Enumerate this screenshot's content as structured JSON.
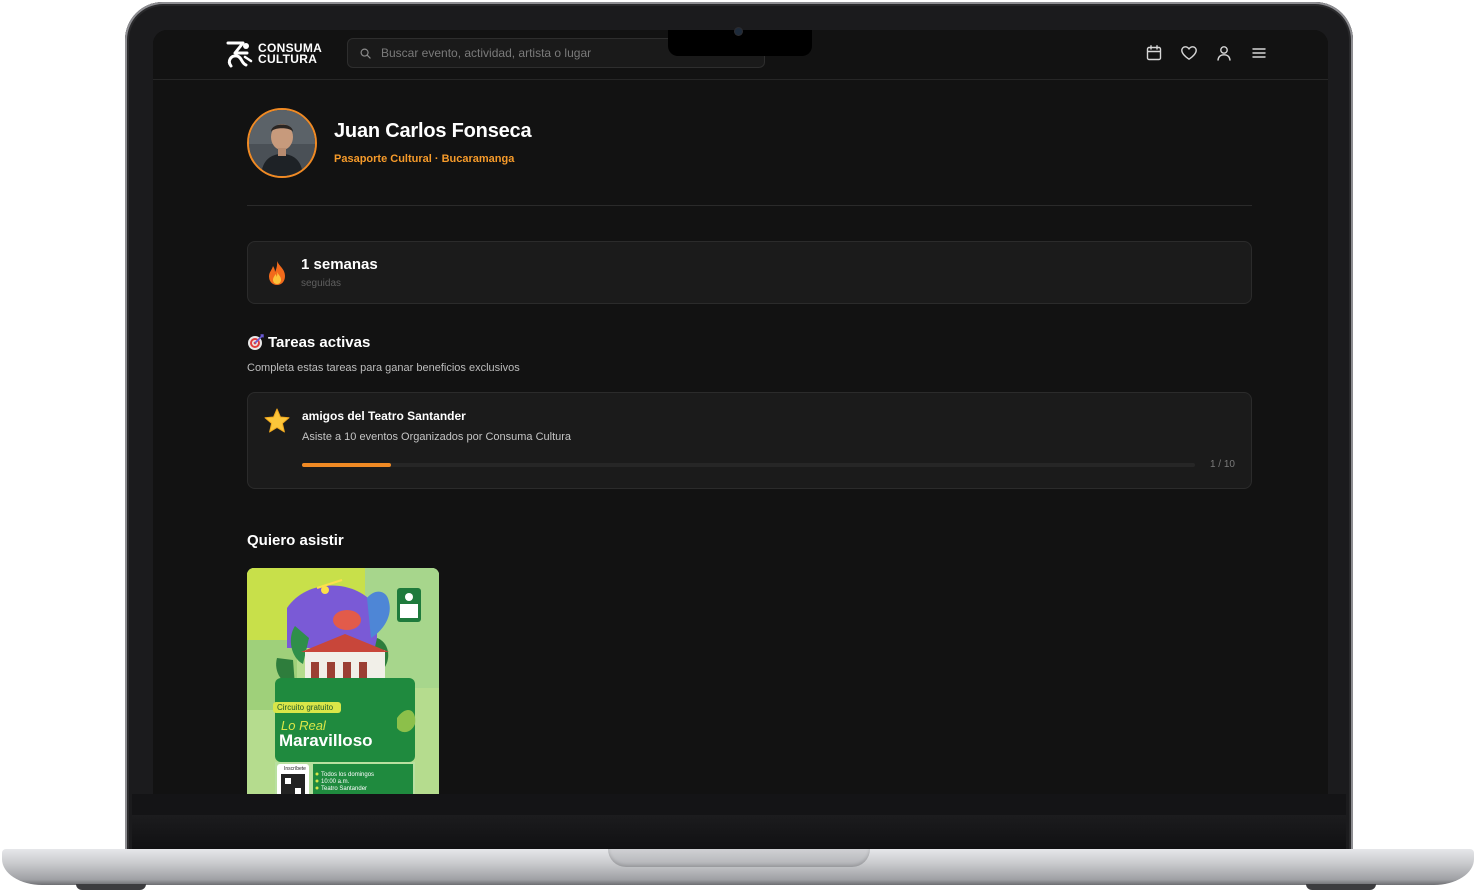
{
  "header": {
    "logo": {
      "line1": "CONSUMA",
      "line2": "CULTURA"
    },
    "search": {
      "placeholder": "Buscar evento, actividad, artista o lugar"
    },
    "icons": [
      "calendar-icon",
      "heart-icon",
      "user-icon",
      "menu-icon"
    ]
  },
  "profile": {
    "name": "Juan Carlos Fonseca",
    "subtitle": "Pasaporte Cultural · Bucaramanga"
  },
  "streak": {
    "count": "1 semanas",
    "label": "seguidas"
  },
  "tasks": {
    "title": "Tareas activas",
    "subtitle": "Completa estas tareas para ganar beneficios exclusivos",
    "items": [
      {
        "title": "amigos del Teatro Santander",
        "description": "Asiste a 10 eventos Organizados por Consuma Cultura",
        "progress_text": "1 / 10",
        "progress_fraction": 0.1
      }
    ]
  },
  "want_to_attend": {
    "title": "Quiero asistir",
    "poster": {
      "tag": "Circuito gratuito",
      "title_line1": "Lo Real",
      "title_line2": "Maravilloso",
      "qr_label": "Inscríbete",
      "details": [
        "Todos los domingos",
        "10:00 a.m.",
        "Teatro Santander"
      ]
    }
  },
  "colors": {
    "accent": "#f08a24",
    "background": "#121212",
    "card": "#1b1b1b"
  }
}
